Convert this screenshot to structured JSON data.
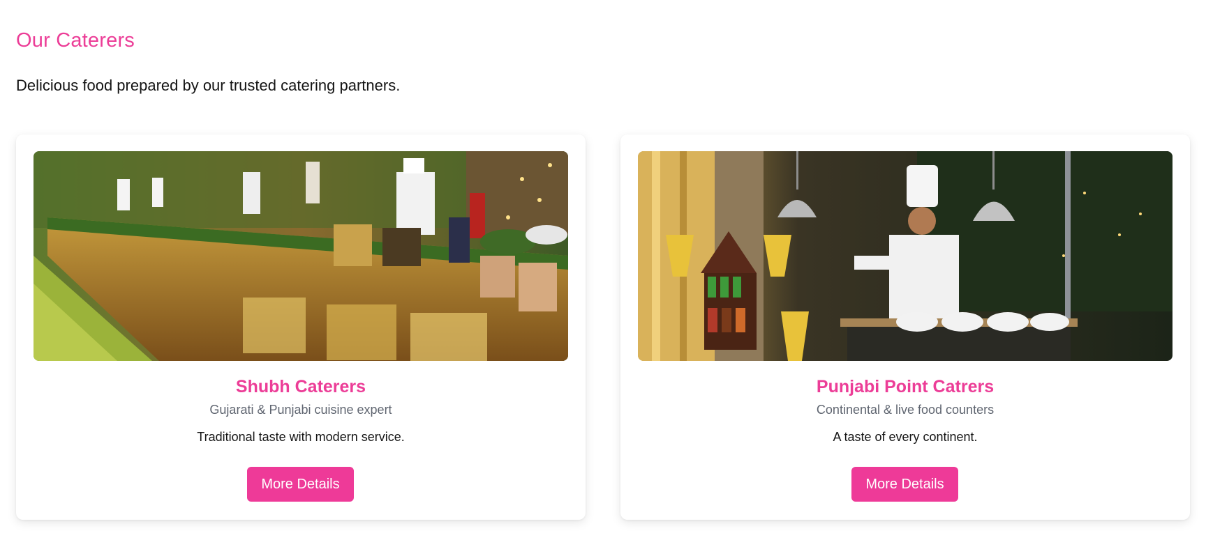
{
  "section": {
    "title": "Our Caterers",
    "subtitle": "Delicious food prepared by our trusted catering partners."
  },
  "caterers": [
    {
      "name": "Shubh Caterers",
      "tagline": "Gujarati & Punjabi cuisine expert",
      "description": "Traditional taste with modern service.",
      "button_label": "More Details"
    },
    {
      "name": "Punjabi Point Catrers",
      "tagline": "Continental & live food counters",
      "description": "A taste of every continent.",
      "button_label": "More Details"
    }
  ],
  "colors": {
    "accent": "#ec3d97",
    "button": "#ee3a98",
    "text": "#141414",
    "muted": "#5f6570"
  }
}
